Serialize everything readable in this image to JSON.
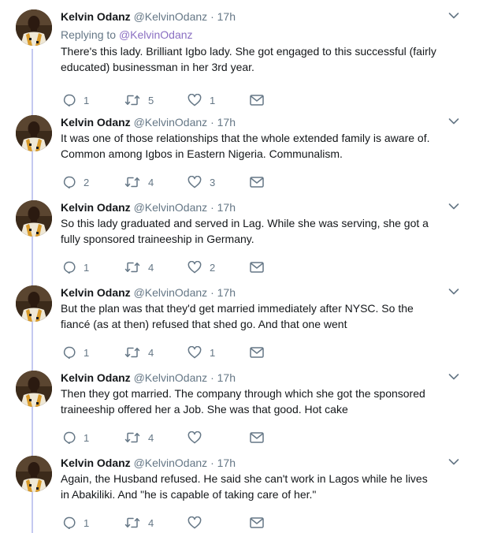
{
  "author": {
    "name": "Kelvin Odanz",
    "handle": "@KelvinOdanz",
    "separator": "·"
  },
  "tweets": [
    {
      "time": "17h",
      "replying_label": "Replying to",
      "replying_to": "@KelvinOdanz",
      "text": "There's this lady. Brilliant Igbo lady. She got engaged to this successful (fairly educated) businessman in her 3rd year.",
      "replies": "1",
      "retweets": "5",
      "likes": "1"
    },
    {
      "time": "17h",
      "text": "It was one of those relationships that the whole extended family is aware of. Common among Igbos in Eastern Nigeria. Communalism.",
      "replies": "2",
      "retweets": "4",
      "likes": "3"
    },
    {
      "time": "17h",
      "text": "So this lady graduated and served in Lag. While she was serving, she got a fully sponsored traineeship in Germany.",
      "replies": "1",
      "retweets": "4",
      "likes": "2"
    },
    {
      "time": "17h",
      "text": "But the plan was that they'd get married immediately after NYSC. So the fiancé (as at then) refused that shed go. And that one went",
      "replies": "1",
      "retweets": "4",
      "likes": "1"
    },
    {
      "time": "17h",
      "text": "Then they got married. The company through which she got the sponsored traineeship offered her a Job. She was that good. Hot cake",
      "replies": "1",
      "retweets": "4",
      "likes": ""
    },
    {
      "time": "17h",
      "text": "Again, the Husband refused. He said she can't work in Lagos while he lives in Abakiliki. And \"he is capable of taking care of her.\"",
      "replies": "1",
      "retweets": "4",
      "likes": ""
    }
  ],
  "icons": {
    "reply": "reply-icon",
    "retweet": "retweet-icon",
    "like": "heart-icon",
    "message": "direct-message-icon",
    "caret": "chevron-down-icon"
  },
  "colors": {
    "icon": "#657786",
    "thread_line": "#c4c9f0",
    "mention": "#8a6fc2"
  }
}
